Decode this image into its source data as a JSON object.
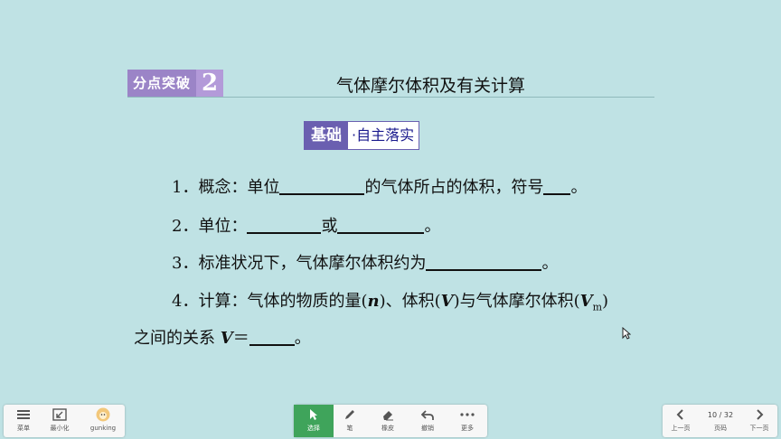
{
  "slide": {
    "section_badge": "分点突破",
    "section_number": "2",
    "section_title": "气体摩尔体积及有关计算",
    "tag_left": "基础",
    "tag_right": "·自主落实",
    "items": {
      "l1_a": "1．概念：单位",
      "l1_b": "的气体所占的体积，符号",
      "l1_c": "。",
      "l2_a": "2．单位：",
      "l2_b": "或",
      "l2_c": "。",
      "l3_a": "3．标准状况下，气体摩尔体积约为",
      "l3_b": "。",
      "l4_a": "4．计算：气体的物质的量(",
      "l4_n": "n",
      "l4_b": ")、体积(",
      "l4_v": "V",
      "l4_c": ")与气体摩尔体积(",
      "l4_vm": "V",
      "l4_m": "m",
      "l4_d": ")",
      "l5_a": "之间的关系 ",
      "l5_v": "V",
      "l5_b": "＝",
      "l5_c": "。"
    }
  },
  "toolbar_left": {
    "menu": "菜单",
    "minimize": "最小化",
    "user": "gunking"
  },
  "toolbar_center": {
    "select": "选择",
    "pen": "笔",
    "eraser": "橡皮",
    "undo": "撤销",
    "more": "更多"
  },
  "toolbar_right": {
    "prev": "上一页",
    "page_indicator": "10 / 32",
    "page_label": "页码",
    "next": "下一页"
  },
  "colors": {
    "background": "#bfe2e4",
    "active_tool": "#3fa45b",
    "badge": "#9b84c7",
    "tag": "#6a5fb0"
  }
}
